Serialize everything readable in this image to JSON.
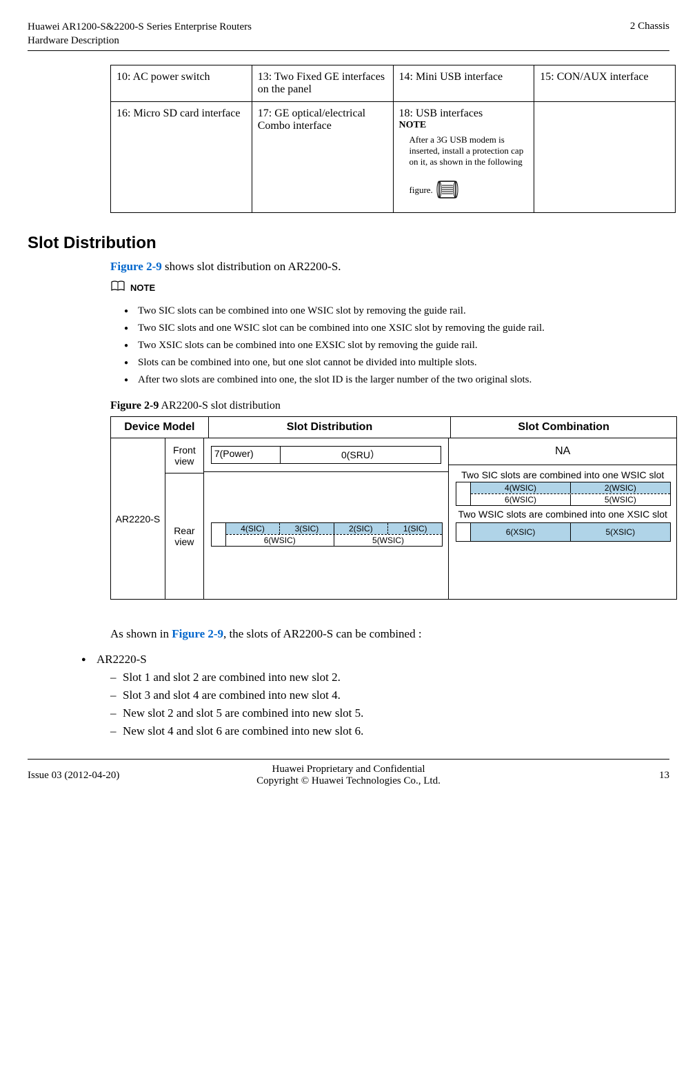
{
  "header": {
    "title_line1": "Huawei AR1200-S&2200-S Series Enterprise Routers",
    "title_line2": "Hardware Description",
    "right": "2 Chassis"
  },
  "interface_table": {
    "row1": {
      "c1": "10: AC power switch",
      "c2": "13: Two Fixed GE interfaces on the panel",
      "c3": "14: Mini USB interface",
      "c4": "15: CON/AUX interface"
    },
    "row2": {
      "c1": "16: Micro SD card interface",
      "c2": "17: GE optical/electrical Combo interface",
      "c3_main": "18: USB interfaces",
      "c3_note_label": "NOTE",
      "c3_note_text": "After a 3G USB modem is inserted, install a protection cap on it, as shown in the following",
      "c3_figure_text": "figure."
    }
  },
  "section_title": "Slot Distribution",
  "slot_intro_pre": "Figure 2-9",
  "slot_intro_post": " shows slot distribution on AR2200-S.",
  "note_label": "NOTE",
  "notes": [
    "Two SIC slots can be combined into one WSIC slot by removing the guide rail.",
    "Two SIC slots and one WSIC slot can be combined into one XSIC slot by removing the guide rail.",
    "Two XSIC slots can be combined into one EXSIC slot by removing the guide rail.",
    "Slots can be combined into one, but one slot cannot be divided into multiple slots.",
    "After two slots are combined into one, the slot ID is the larger number of the two original slots."
  ],
  "fig_title_bold": "Figure 2-9",
  "fig_title_rest": " AR2200-S slot distribution",
  "chart_data": {
    "type": "table",
    "headers": [
      "Device Model",
      "Slot Distribution",
      "Slot Combination"
    ],
    "device_model": "AR2220-S",
    "front_view_label": "Front view",
    "rear_view_label": "Rear view",
    "front_view_slots": {
      "power": "7(Power)",
      "sru": "0(SRU）"
    },
    "front_comb": "NA",
    "rear_view_slots": {
      "sic": [
        "4(SIC)",
        "3(SIC)",
        "2(SIC)",
        "1(SIC)"
      ],
      "wsic": [
        "6(WSIC)",
        "5(WSIC)"
      ]
    },
    "comb1_title": "Two SIC slots are combined into one WSIC slot",
    "comb1_top": [
      "4(WSIC)",
      "2(WSIC)"
    ],
    "comb1_bottom": [
      "6(WSIC)",
      "5(WSIC)"
    ],
    "comb2_title": "Two WSIC slots are combined into one XSIC slot",
    "comb2": [
      "6(XSIC)",
      "5(XSIC)"
    ]
  },
  "combined_intro_pre": "As shown in ",
  "combined_intro_link": "Figure 2-9",
  "combined_intro_post": ", the slots of AR2200-S can be combined :",
  "model_name": "AR2220-S",
  "sub_items": [
    "Slot 1 and slot 2 are combined into new slot 2.",
    "Slot 3 and slot 4 are combined into new slot 4.",
    "New slot 2 and slot 5 are combined into new slot 5.",
    "New slot 4 and slot 6 are combined into new slot 6."
  ],
  "footer": {
    "left": "Issue 03 (2012-04-20)",
    "center_line1": "Huawei Proprietary and Confidential",
    "center_line2": "Copyright © Huawei Technologies Co., Ltd.",
    "right": "13"
  }
}
